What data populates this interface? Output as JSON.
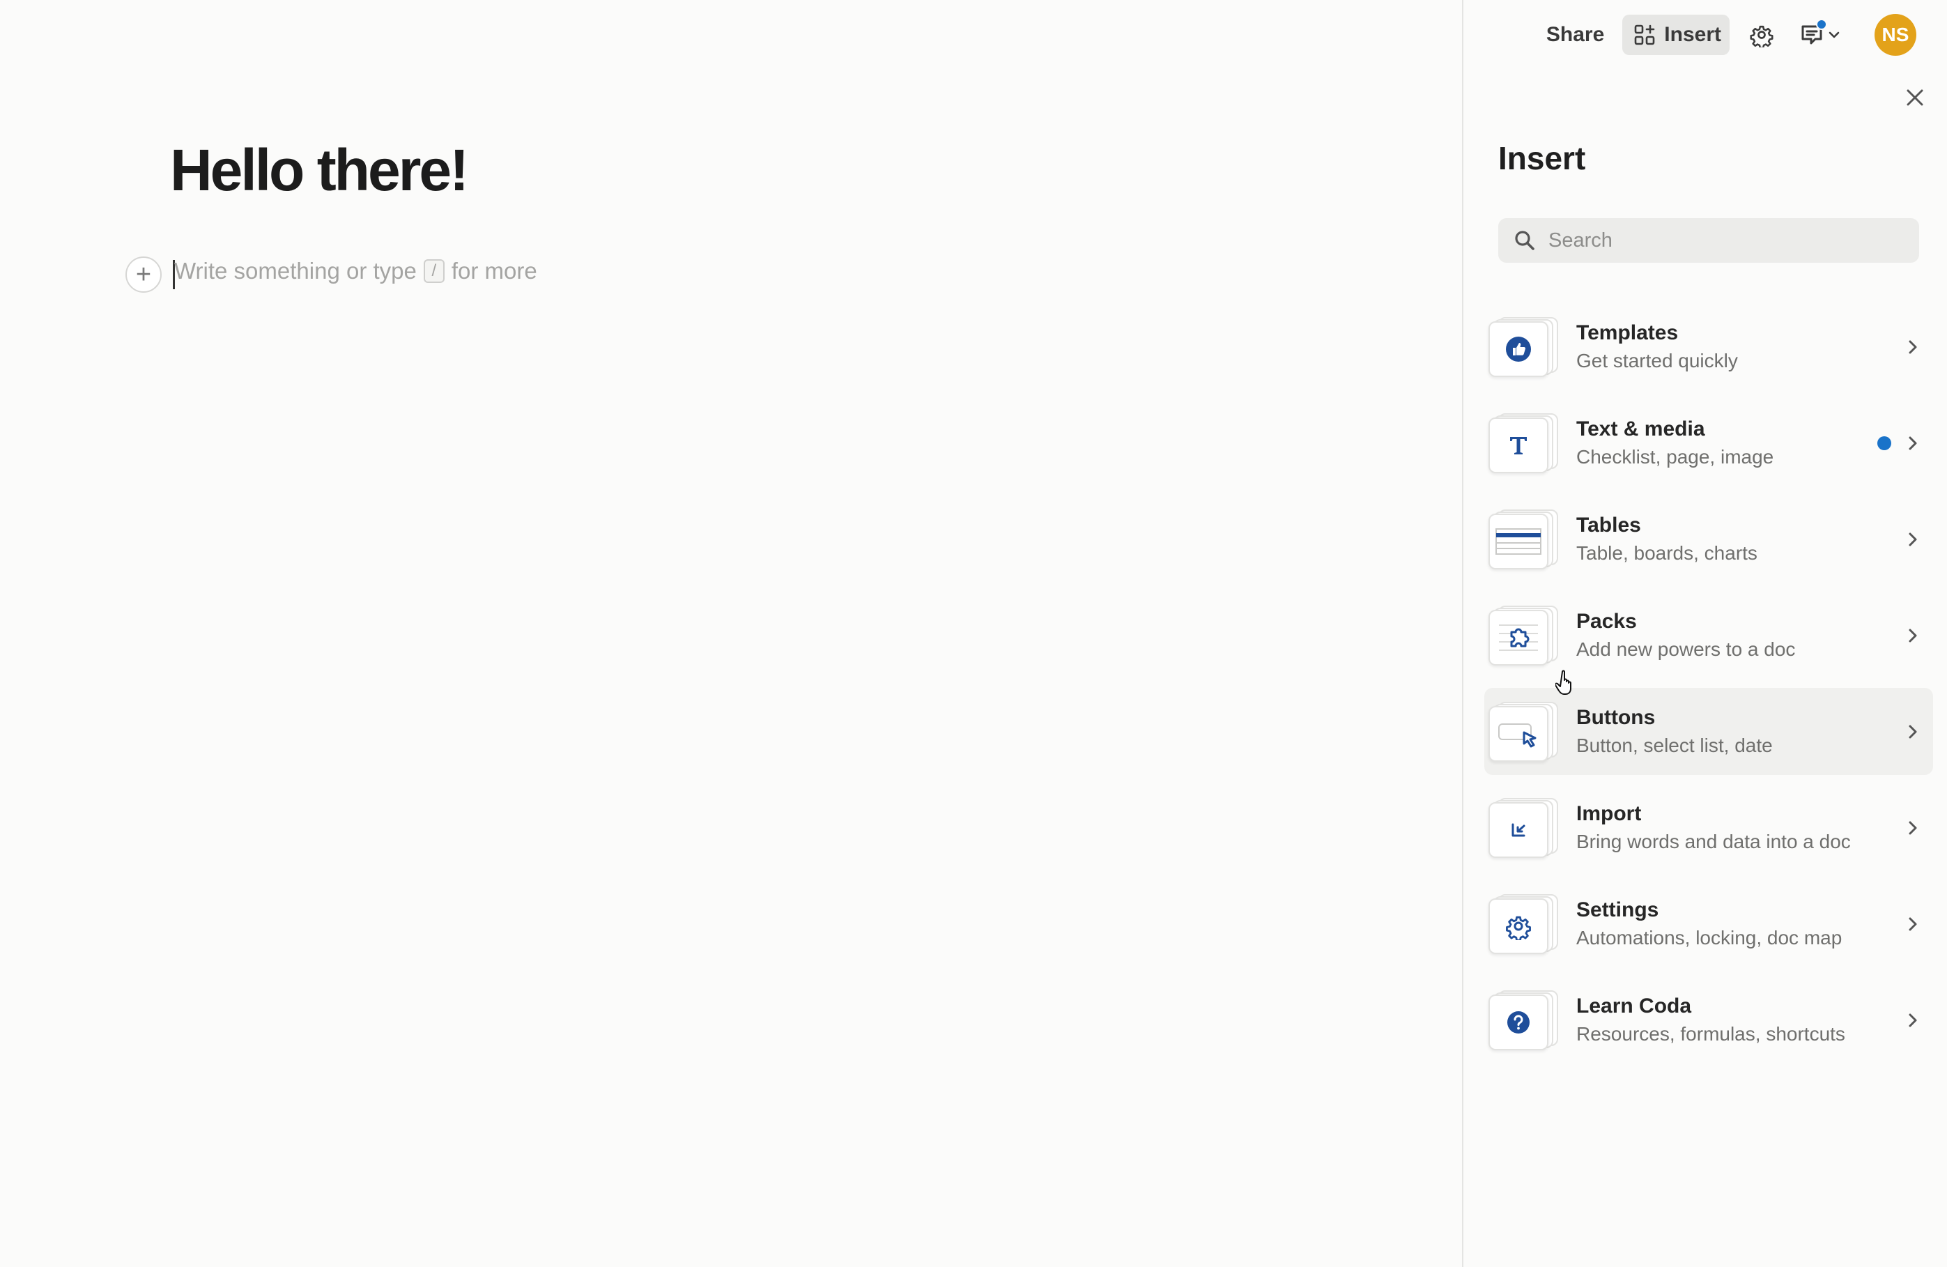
{
  "editor": {
    "title": "Hello there!",
    "placeholder_before": "Write something or type",
    "placeholder_key": "/",
    "placeholder_after": "for more"
  },
  "topbar": {
    "share_label": "Share",
    "insert_label": "Insert",
    "avatar_initials": "NS"
  },
  "panel": {
    "title": "Insert",
    "search_placeholder": "Search",
    "items": [
      {
        "title": "Templates",
        "subtitle": "Get started quickly",
        "icon": "thumbs-up-icon"
      },
      {
        "title": "Text & media",
        "subtitle": "Checklist, page, image",
        "icon": "text-t-icon",
        "has_dot": true
      },
      {
        "title": "Tables",
        "subtitle": "Table, boards, charts",
        "icon": "table-icon"
      },
      {
        "title": "Packs",
        "subtitle": "Add new powers to a doc",
        "icon": "puzzle-icon"
      },
      {
        "title": "Buttons",
        "subtitle": "Button, select list, date",
        "icon": "button-cursor-icon",
        "hovered": true
      },
      {
        "title": "Import",
        "subtitle": "Bring words and data into a doc",
        "icon": "import-icon"
      },
      {
        "title": "Settings",
        "subtitle": "Automations, locking, doc map",
        "icon": "gear-icon"
      },
      {
        "title": "Learn Coda",
        "subtitle": "Resources, formulas, shortcuts",
        "icon": "question-icon"
      }
    ]
  },
  "colors": {
    "accent": "#1a73c9",
    "icon_blue": "#1f4e9a",
    "avatar_bg": "#e3a21a",
    "background": "#fbfbfa"
  }
}
